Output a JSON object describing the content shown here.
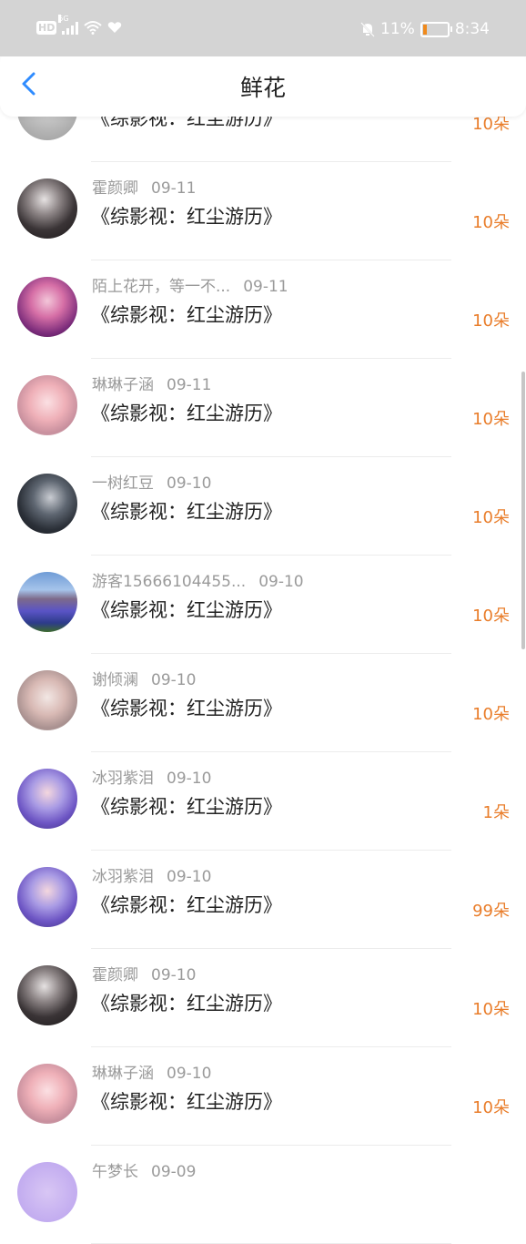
{
  "status_bar": {
    "hd": "HD",
    "network": "5G",
    "battery_text": "11%",
    "time": "8:34",
    "icons": [
      "signal-icon",
      "wifi-icon",
      "heart-icon",
      "mute-bell-icon",
      "battery-icon"
    ],
    "battery_level": 0.11
  },
  "header": {
    "title": "鲜花",
    "back_icon": "chevron-left-icon",
    "accent": "#2f8cff"
  },
  "colors": {
    "amount": "#e97d2a",
    "meta": "#9a9a9a",
    "title": "#222222"
  },
  "items": [
    {
      "name": "",
      "date": "",
      "title": "《综影视：红尘游历》",
      "amount": "10朵",
      "avatar": "grey-photo"
    },
    {
      "name": "霍颜卿",
      "date": "09-11",
      "title": "《综影视：红尘游历》",
      "amount": "10朵",
      "avatar": "dark-portrait"
    },
    {
      "name": "陌上花开，等一不...",
      "date": "09-11",
      "title": "《综影视：红尘游历》",
      "amount": "10朵",
      "avatar": "purple-portrait"
    },
    {
      "name": "琳琳子涵",
      "date": "09-11",
      "title": "《综影视：红尘游历》",
      "amount": "10朵",
      "avatar": "pink-anime-girl"
    },
    {
      "name": "一树红豆",
      "date": "09-10",
      "title": "《综影视：红尘游历》",
      "amount": "10朵",
      "avatar": "dark-anime"
    },
    {
      "name": "游客15666104455...",
      "date": "09-10",
      "title": "《综影视：红尘游历》",
      "amount": "10朵",
      "avatar": "lavender-field"
    },
    {
      "name": "谢倾澜",
      "date": "09-10",
      "title": "《综影视：红尘游历》",
      "amount": "10朵",
      "avatar": "ancient-costume"
    },
    {
      "name": "冰羽紫泪",
      "date": "09-10",
      "title": "《综影视：红尘游历》",
      "amount": "1朵",
      "avatar": "purple-costume"
    },
    {
      "name": "冰羽紫泪",
      "date": "09-10",
      "title": "《综影视：红尘游历》",
      "amount": "99朵",
      "avatar": "purple-costume"
    },
    {
      "name": "霍颜卿",
      "date": "09-10",
      "title": "《综影视：红尘游历》",
      "amount": "10朵",
      "avatar": "dark-portrait"
    },
    {
      "name": "琳琳子涵",
      "date": "09-10",
      "title": "《综影视：红尘游历》",
      "amount": "10朵",
      "avatar": "pink-anime-girl"
    },
    {
      "name": "午梦长",
      "date": "09-09",
      "title": "",
      "amount": "",
      "avatar": "violet-circle"
    }
  ]
}
